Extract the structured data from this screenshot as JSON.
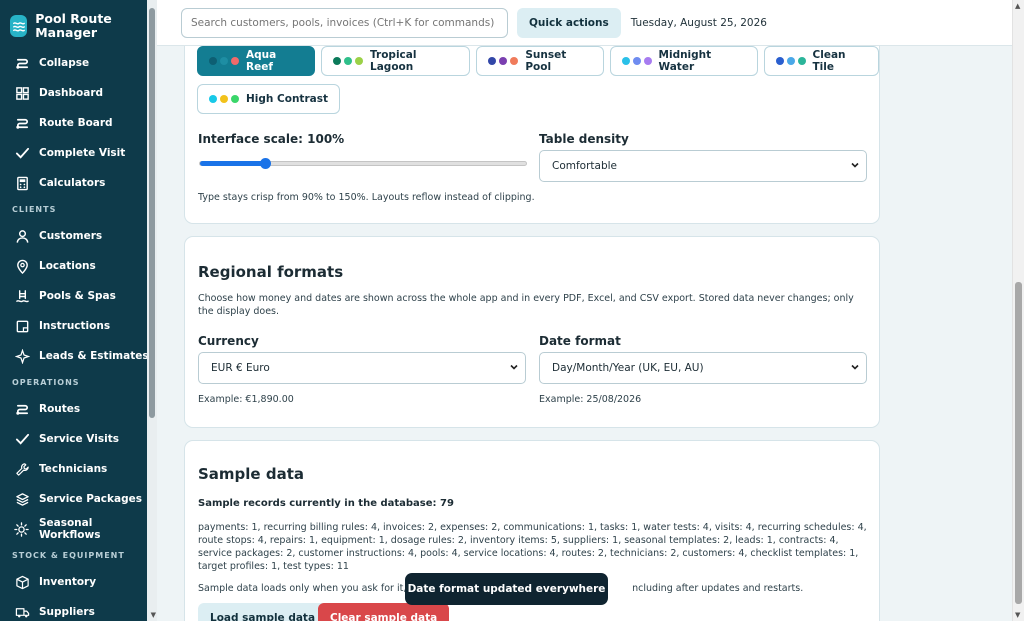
{
  "brand": {
    "name": "Pool Route Manager",
    "icon": "pool-wave-icon",
    "color": "#27b3c7"
  },
  "sidebar": {
    "bg": "#0e3a4a",
    "top_items": [
      {
        "label": "Collapse",
        "icon": "wave-icon"
      },
      {
        "label": "Dashboard",
        "icon": "grid-icon"
      },
      {
        "label": "Route Board",
        "icon": "route-icon"
      },
      {
        "label": "Complete Visit",
        "icon": "check-icon"
      },
      {
        "label": "Calculators",
        "icon": "calculator-icon"
      }
    ],
    "sections": [
      {
        "title": "CLIENTS",
        "items": [
          {
            "label": "Customers",
            "icon": "user-icon"
          },
          {
            "label": "Locations",
            "icon": "pin-icon"
          },
          {
            "label": "Pools & Spas",
            "icon": "ladder-icon"
          },
          {
            "label": "Instructions",
            "icon": "note-icon"
          },
          {
            "label": "Leads & Estimates",
            "icon": "sparkle-icon"
          }
        ]
      },
      {
        "title": "OPERATIONS",
        "items": [
          {
            "label": "Routes",
            "icon": "route-icon"
          },
          {
            "label": "Service Visits",
            "icon": "check-icon"
          },
          {
            "label": "Technicians",
            "icon": "wrench-icon"
          },
          {
            "label": "Service Packages",
            "icon": "layers-icon"
          },
          {
            "label": "Seasonal Workflows",
            "icon": "sun-icon"
          }
        ]
      },
      {
        "title": "STOCK & EQUIPMENT",
        "items": [
          {
            "label": "Inventory",
            "icon": "box-icon"
          },
          {
            "label": "Suppliers",
            "icon": "truck-icon"
          }
        ]
      }
    ]
  },
  "topbar": {
    "search_placeholder": "Search customers, pools, invoices (Ctrl+K for commands)",
    "quick_actions": "Quick actions",
    "date": "Tuesday, August 25, 2026"
  },
  "appearance": {
    "themes": [
      {
        "name": "Aqua Reef",
        "active": true,
        "colors": [
          "#0d5f73",
          "#1e8ea3",
          "#f06a6a"
        ]
      },
      {
        "name": "Tropical Lagoon",
        "active": false,
        "colors": [
          "#0b7a5a",
          "#2fbf8a",
          "#9bd147"
        ]
      },
      {
        "name": "Sunset Pool",
        "active": false,
        "colors": [
          "#3247a8",
          "#7a3fb0",
          "#f07b5b"
        ]
      },
      {
        "name": "Midnight Water",
        "active": false,
        "colors": [
          "#2ac0e8",
          "#6f8cf0",
          "#a77cf0"
        ]
      },
      {
        "name": "Clean Tile",
        "active": false,
        "colors": [
          "#2a5fcf",
          "#4aa8e8",
          "#2bb59a"
        ]
      },
      {
        "name": "High Contrast",
        "active": false,
        "colors": [
          "#18c9e8",
          "#f2c21b",
          "#3ad66a"
        ]
      }
    ],
    "scale_label": "Interface scale: 100%",
    "scale_fraction": 0.2,
    "density_label": "Table density",
    "density_value": "Comfortable",
    "scale_hint": "Type stays crisp from 90% to 150%. Layouts reflow instead of clipping."
  },
  "regional": {
    "title": "Regional formats",
    "description": "Choose how money and dates are shown across the whole app and in every PDF, Excel, and CSV export. Stored data never changes; only the display does.",
    "currency_label": "Currency",
    "currency_value": "EUR € Euro",
    "currency_example": "Example: €1,890.00",
    "date_label": "Date format",
    "date_value": "Day/Month/Year (UK, EU, AU)",
    "date_example": "Example: 25/08/2026"
  },
  "sample": {
    "title": "Sample data",
    "count_label": "Sample records currently in the database:",
    "count": "79",
    "breakdown": "payments: 1, recurring billing rules: 4, invoices: 2, expenses: 2, communications: 1, tasks: 1, water tests: 4, visits: 4, recurring schedules: 4, route stops: 4, repairs: 1, equipment: 1, dosage rules: 2, inventory items: 5, suppliers: 1, seasonal templates: 2, leads: 1, contracts: 4, service packages: 2, customer instructions: 4, pools: 4, service locations: 4, routes: 2, technicians: 2, customers: 4, checklist templates: 1, target profiles: 1, test types: 11",
    "note_left": "Sample data loads only when you ask for it, ar",
    "note_right": "ncluding after updates and restarts.",
    "load_label": "Load sample data",
    "clear_label": "Clear sample data",
    "clear_color": "#d9474a"
  },
  "toast": {
    "message": "Date format updated everywhere"
  }
}
